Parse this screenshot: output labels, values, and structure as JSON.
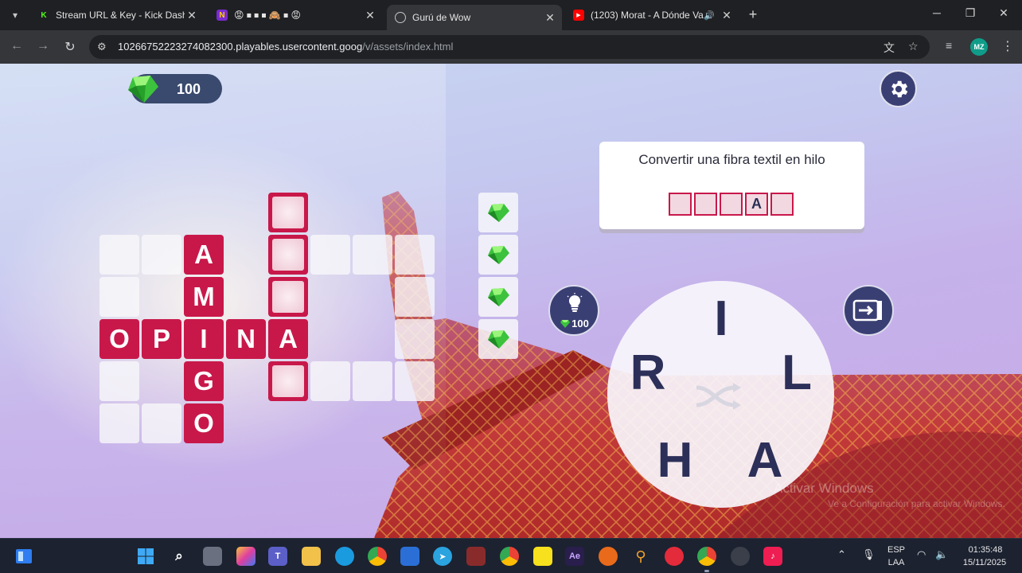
{
  "browser": {
    "tabs": [
      {
        "title": "Stream URL & Key - Kick Dashb",
        "favicon": "kick-icon",
        "color": "#53fc18",
        "active": false
      },
      {
        "title": "😡 ⏹ ⏹ ⏹ 🙈 ⏹ 😡",
        "favicon": "app-icon",
        "color": "#7b2bd1",
        "active": false
      },
      {
        "title": "Gurú de Wow",
        "favicon": "globe-icon",
        "color": "#9aa0a6",
        "active": true
      },
      {
        "title": "(1203) Morat - A Dónde Va",
        "favicon": "youtube-icon",
        "color": "#ff0000",
        "active": false
      }
    ],
    "url_host": "1026675222327408230​0.playables.usercontent.goog",
    "url_path": "/v/assets/index.html",
    "profile_initials": "MZ"
  },
  "game": {
    "gems": "100",
    "clue": {
      "text": "Convertir una fibra textil en hilo",
      "slots": [
        "",
        "",
        "",
        "A",
        ""
      ]
    },
    "hint_cost": "100",
    "wheel_letters": [
      "I",
      "L",
      "A",
      "H",
      "R"
    ],
    "grid": [
      {
        "r": 0,
        "c": 4,
        "t": "hint"
      },
      {
        "r": 1,
        "c": 0,
        "t": "empty"
      },
      {
        "r": 1,
        "c": 1,
        "t": "empty"
      },
      {
        "r": 1,
        "c": 2,
        "t": "letter",
        "v": "A"
      },
      {
        "r": 1,
        "c": 4,
        "t": "hint"
      },
      {
        "r": 1,
        "c": 5,
        "t": "empty"
      },
      {
        "r": 1,
        "c": 6,
        "t": "empty"
      },
      {
        "r": 1,
        "c": 7,
        "t": "empty"
      },
      {
        "r": 2,
        "c": 0,
        "t": "empty"
      },
      {
        "r": 2,
        "c": 2,
        "t": "letter",
        "v": "M"
      },
      {
        "r": 2,
        "c": 4,
        "t": "hint"
      },
      {
        "r": 2,
        "c": 7,
        "t": "empty"
      },
      {
        "r": 3,
        "c": 0,
        "t": "letter",
        "v": "O"
      },
      {
        "r": 3,
        "c": 1,
        "t": "letter",
        "v": "P"
      },
      {
        "r": 3,
        "c": 2,
        "t": "letter",
        "v": "I"
      },
      {
        "r": 3,
        "c": 3,
        "t": "letter",
        "v": "N"
      },
      {
        "r": 3,
        "c": 4,
        "t": "letter",
        "v": "A"
      },
      {
        "r": 3,
        "c": 7,
        "t": "empty"
      },
      {
        "r": 4,
        "c": 0,
        "t": "empty"
      },
      {
        "r": 4,
        "c": 2,
        "t": "letter",
        "v": "G"
      },
      {
        "r": 4,
        "c": 4,
        "t": "hint"
      },
      {
        "r": 4,
        "c": 5,
        "t": "empty"
      },
      {
        "r": 4,
        "c": 6,
        "t": "empty"
      },
      {
        "r": 4,
        "c": 7,
        "t": "empty"
      },
      {
        "r": 5,
        "c": 0,
        "t": "empty"
      },
      {
        "r": 5,
        "c": 1,
        "t": "empty"
      },
      {
        "r": 5,
        "c": 2,
        "t": "letter",
        "v": "O"
      }
    ],
    "bonus_slots": 4,
    "watermark_line1": "Activar Windows",
    "watermark_line2": "Ve a Configuración para activar Windows."
  },
  "taskbar": {
    "lang_top": "ESP",
    "lang_bottom": "LAA",
    "time": "01:35:48",
    "date": "15/11/2025"
  },
  "colors": {
    "tile": "#c8184a",
    "letter_dark": "#2c2f58",
    "button_dark": "#3a3f73"
  }
}
